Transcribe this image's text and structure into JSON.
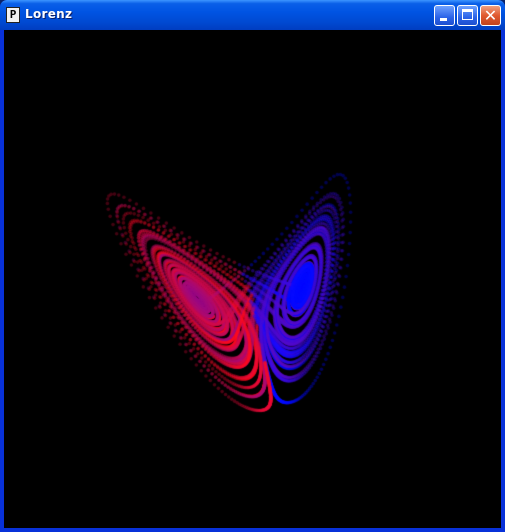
{
  "window": {
    "title": "Lorenz",
    "app_icon_glyph": "P",
    "icons": {
      "app": "processing-app-icon",
      "minimize": "minimize-icon",
      "maximize": "maximize-icon",
      "close": "close-icon"
    },
    "close_glyph": "✕"
  },
  "canvas": {
    "background": "#000000",
    "colors": {
      "red": "#ff1030",
      "blue": "#1a1aff"
    },
    "description_icon": "lorenz-attractor-plot"
  }
}
